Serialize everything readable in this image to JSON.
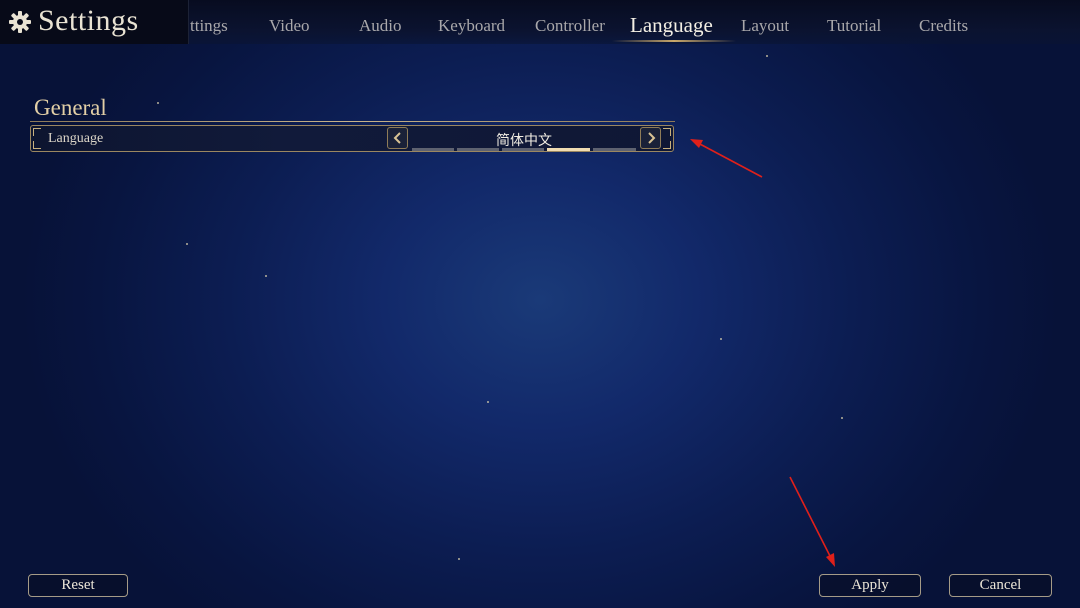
{
  "header": {
    "title": "Settings",
    "tabs": [
      {
        "label": "ttings",
        "active": false
      },
      {
        "label": "Video",
        "active": false
      },
      {
        "label": "Audio",
        "active": false
      },
      {
        "label": "Keyboard",
        "active": false
      },
      {
        "label": "Controller",
        "active": false
      },
      {
        "label": "Language",
        "active": true
      },
      {
        "label": "Layout",
        "active": false
      },
      {
        "label": "Tutorial",
        "active": false
      },
      {
        "label": "Credits",
        "active": false
      }
    ]
  },
  "section": {
    "title": "General",
    "rows": [
      {
        "label": "Language",
        "value": "简体中文",
        "option_count": 5,
        "selected_index": 3
      }
    ]
  },
  "footer": {
    "reset_label": "Reset",
    "apply_label": "Apply",
    "cancel_label": "Cancel"
  },
  "icons": {
    "title": "gear-icon",
    "prev": "chevron-left-icon",
    "next": "chevron-right-icon"
  },
  "colors": {
    "accent_gold": "#c9a86a",
    "annotation_red": "#e0201a",
    "selected_pip": "#f0dcb2"
  }
}
